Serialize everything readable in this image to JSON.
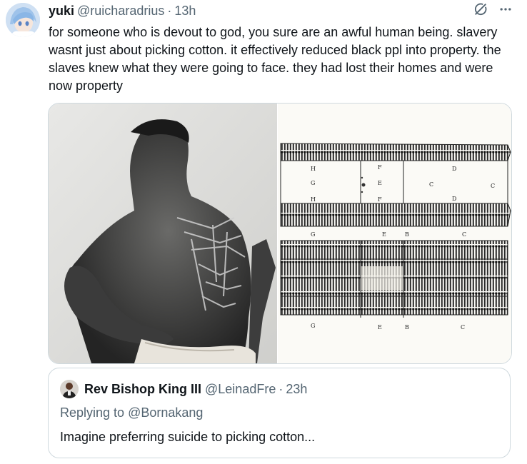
{
  "tweet": {
    "author_name": "yuki",
    "author_handle": "@ruicharadrius",
    "separator": "·",
    "time": "13h",
    "text": "for someone who is devout to god, you sure are an awful human being. slavery wasnt just about picking cotton. it effectively reduced black ppl into property. the slaves knew what they were going to face. they had lost their homes and were now property",
    "icons": {
      "grok": "grok-icon",
      "more": "more-icon"
    },
    "media": [
      {
        "kind": "photo",
        "subject": "scarred-back-photo"
      },
      {
        "kind": "photo",
        "subject": "slave-ship-diagram",
        "labels": [
          "H",
          "F",
          "D",
          "G",
          "E",
          "C",
          "C",
          "H",
          "F",
          "D",
          "G",
          "E",
          "B",
          "C",
          "G",
          "E",
          "B",
          "C"
        ]
      }
    ]
  },
  "quote": {
    "author_name": "Rev Bishop King III",
    "author_handle": "@LeinadFre",
    "separator": "·",
    "time": "23h",
    "replying_prefix": "Replying to",
    "replying_to": "@Bornakang",
    "text": "Imagine preferring suicide to picking cotton..."
  },
  "colors": {
    "text": "#0f1419",
    "secondary": "#536471",
    "border": "#cfd9de"
  }
}
